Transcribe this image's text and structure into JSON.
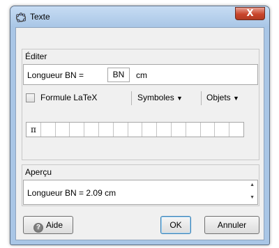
{
  "window": {
    "title": "Texte",
    "close_symbol": "X"
  },
  "edit_group": {
    "label": "Éditer",
    "text_before": "Longueur BN = ",
    "chip_value": "BN",
    "text_after": "cm"
  },
  "toolbar": {
    "latex_label": "Formule LaTeX",
    "symbols_label": "Symboles",
    "objects_label": "Objets",
    "caret": "▼"
  },
  "symbols_row": [
    "π",
    "",
    "",
    "",
    "",
    "",
    "",
    "",
    "",
    "",
    "",
    "",
    "",
    "",
    ""
  ],
  "preview_group": {
    "label": "Aperçu",
    "text": "Longueur BN = 2.09  cm",
    "scroll_up": "▲",
    "scroll_down": "▼"
  },
  "buttons": {
    "help": "Aide",
    "help_icon_glyph": "?",
    "ok": "OK",
    "cancel": "Annuler"
  }
}
